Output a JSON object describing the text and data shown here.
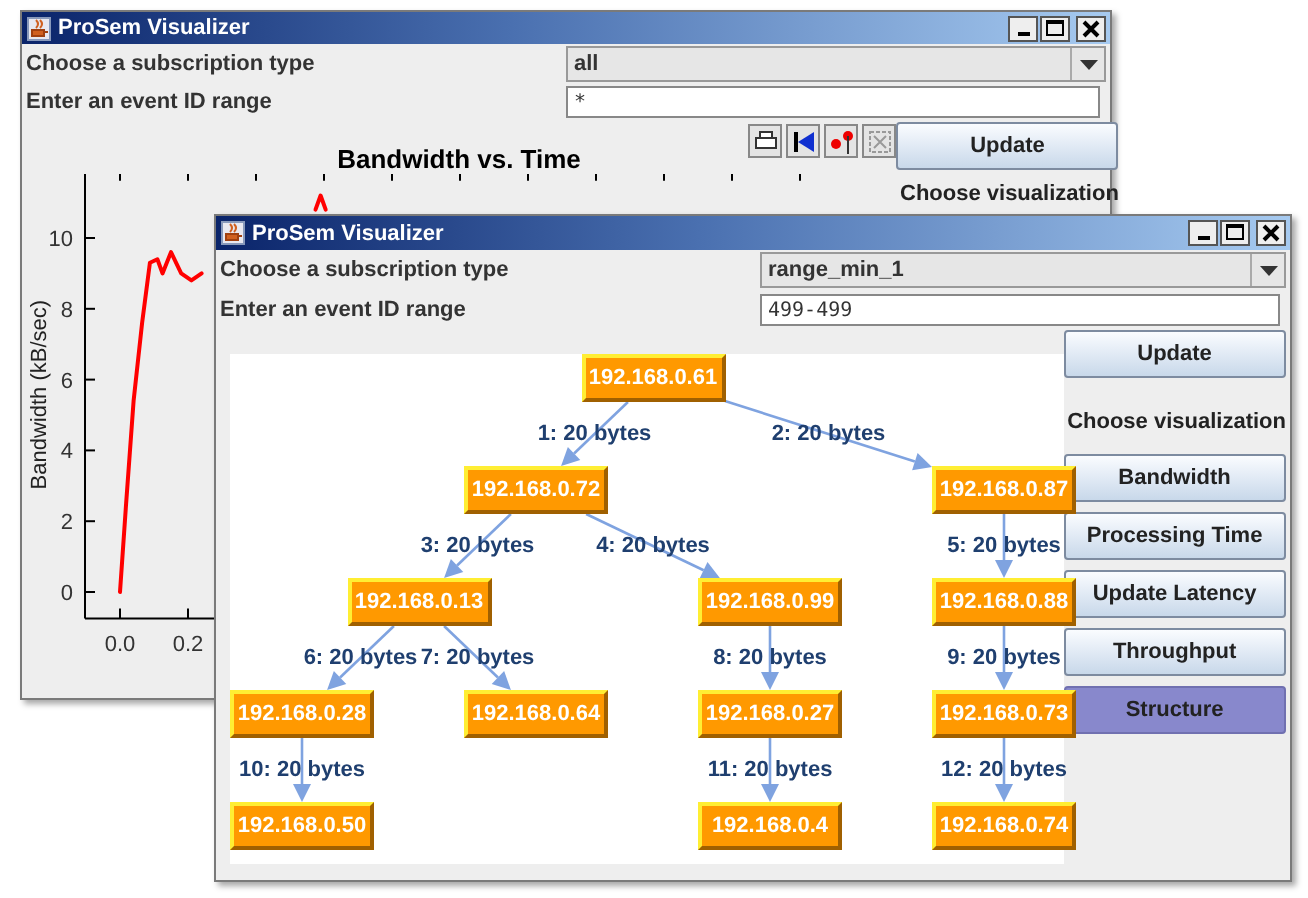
{
  "back_window": {
    "title": "ProSem Visualizer",
    "subscription_label": "Choose a subscription type",
    "subscription_value": "all",
    "range_label": "Enter an event ID range",
    "range_value": "*",
    "update_button": "Update",
    "visualization_label": "Choose visualization",
    "chart_data": {
      "type": "line",
      "title": "Bandwidth vs. Time",
      "ylabel": "Bandwidth (kB/sec)",
      "xlim": [
        -0.1,
        2.13
      ],
      "ylim": [
        -0.75,
        11.9
      ],
      "xticks": [
        {
          "value": 0,
          "label": "0.0"
        },
        {
          "value": 0.2,
          "label": "0.2"
        }
      ],
      "yticks": [
        0,
        2,
        4,
        6,
        8,
        10
      ],
      "x": [
        0,
        0.018,
        0.04,
        0.065,
        0.088,
        0.11,
        0.125,
        0.15,
        0.18,
        0.21,
        0.24,
        0.575,
        0.59,
        0.605
      ],
      "series": [
        {
          "color": "#ff0000",
          "values": [
            0,
            2.5,
            5.4,
            7.6,
            9.3,
            9.4,
            9.0,
            9.6,
            9.0,
            8.8,
            9.0,
            null,
            null,
            null
          ]
        },
        {
          "color": "#ff0000",
          "values": [
            null,
            null,
            null,
            null,
            null,
            null,
            null,
            null,
            null,
            null,
            null,
            10.8,
            11.2,
            10.8
          ]
        }
      ]
    }
  },
  "front_window": {
    "title": "ProSem Visualizer",
    "subscription_label": "Choose a subscription type",
    "subscription_value": "range_min_1",
    "range_label": "Enter an event ID range",
    "range_value": "499-499",
    "update_button": "Update",
    "visualization_label": "Choose visualization",
    "visualizations": [
      {
        "label": "Bandwidth",
        "selected": false
      },
      {
        "label": "Processing Time",
        "selected": false
      },
      {
        "label": "Update Latency",
        "selected": false
      },
      {
        "label": "Throughput",
        "selected": false
      },
      {
        "label": "Structure",
        "selected": true
      }
    ],
    "tree": {
      "label": "192.168.0.61",
      "children": [
        {
          "edge_label": "1: 20 bytes",
          "label": "192.168.0.72",
          "children": [
            {
              "edge_label": "3: 20 bytes",
              "label": "192.168.0.13",
              "children": [
                {
                  "edge_label": "6: 20 bytes",
                  "label": "192.168.0.28",
                  "children": [
                    {
                      "edge_label": "10: 20 bytes",
                      "label": "192.168.0.50"
                    }
                  ]
                },
                {
                  "edge_label": "7: 20 bytes",
                  "label": "192.168.0.64"
                }
              ]
            },
            {
              "edge_label": "4: 20 bytes",
              "label": "192.168.0.99",
              "children": [
                {
                  "edge_label": "8: 20 bytes",
                  "label": "192.168.0.27",
                  "children": [
                    {
                      "edge_label": "11: 20 bytes",
                      "label": "192.168.0.4"
                    }
                  ]
                }
              ]
            }
          ]
        },
        {
          "edge_label": "2: 20 bytes",
          "label": "192.168.0.87",
          "children": [
            {
              "edge_label": "5: 20 bytes",
              "label": "192.168.0.88",
              "children": [
                {
                  "edge_label": "9: 20 bytes",
                  "label": "192.168.0.73",
                  "children": [
                    {
                      "edge_label": "12: 20 bytes",
                      "label": "192.168.0.74"
                    }
                  ]
                }
              ]
            }
          ]
        }
      ]
    }
  }
}
